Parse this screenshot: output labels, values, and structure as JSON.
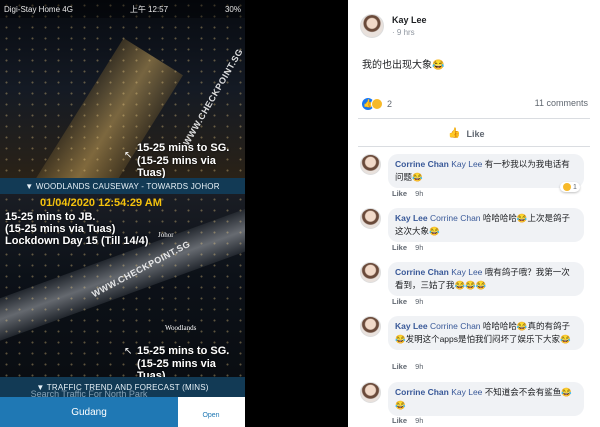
{
  "phone": {
    "carrier": "Digi-Stay Home 4G",
    "time": "上午 12:57",
    "battery": "30%"
  },
  "cam1": {
    "line1": "15-25 mins to SG.",
    "line2": "(15-25 mins via Tuas)",
    "watermark": "WWW.CHECKPOINT.SG"
  },
  "banner1": "▼ WOODLANDS CAUSEWAY - TOWARDS JOHOR",
  "cam2": {
    "timestamp": "01/04/2020 12:54:29 AM",
    "jb_line1": "15-25 mins to JB.",
    "jb_line2": "(15-25 mins via Tuas)",
    "jb_line3": "Lockdown Day 15 (Till 14/4)",
    "johor_label": "Johor",
    "woodlands_label": "Woodlands",
    "watermark": "WWW.CHECKPOINT.SG",
    "sg_line1": "15-25 mins to SG.",
    "sg_line2": "(15-25 mins via Tuas)"
  },
  "banner2": "▼ TRAFFIC TREND AND FORECAST (MINS)",
  "bottom": {
    "faded": "Search Traffic For North Park",
    "button": "Gudang",
    "open": "Open"
  },
  "post": {
    "author": "Kay Lee",
    "time": "9 hrs",
    "text": "我的也出现大象😂",
    "reaction_count": "2",
    "comments_count": "11 comments",
    "like_label": "Like"
  },
  "comments": [
    {
      "name": "Corrine Chan",
      "tag": "Kay Lee",
      "text": "有一秒我以为我电话有问题😂",
      "like": "Like",
      "time": "9h",
      "react": "1"
    },
    {
      "name": "Kay Lee",
      "tag": "Corrine Chan",
      "text": "哈哈哈哈😂上次是鸽子这次大象😂",
      "like": "Like",
      "time": "9h"
    },
    {
      "name": "Corrine Chan",
      "tag": "Kay Lee",
      "text": "哦有鸽子哦？我第一次看到，三姑了我😂😂😂",
      "like": "Like",
      "time": "9h"
    },
    {
      "name": "Kay Lee",
      "tag": "Corrine Chan",
      "text": "哈哈哈哈😂真的有鸽子😂发明这个apps是怕我们闷坏了娱乐下大家😂",
      "like": "Like",
      "time": "9h"
    },
    {
      "name": "Corrine Chan",
      "tag": "Kay Lee",
      "text": "不知道会不会有鲨鱼😂😂",
      "like": "Like",
      "time": "9h"
    }
  ]
}
